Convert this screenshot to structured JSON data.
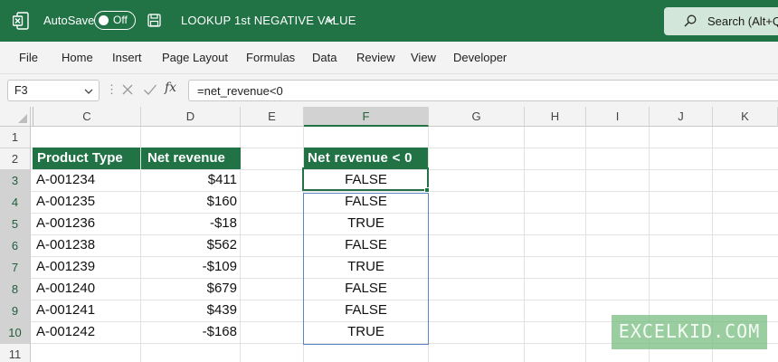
{
  "title_bar": {
    "autosave_label": "AutoSave",
    "autosave_state": "Off",
    "document_title": "LOOKUP 1st NEGATIVE VALUE",
    "search_placeholder": "Search (Alt+Q)",
    "accent_color": "#217346"
  },
  "ribbon": {
    "tabs": [
      "File",
      "Home",
      "Insert",
      "Page Layout",
      "Formulas",
      "Data",
      "Review",
      "View",
      "Developer"
    ]
  },
  "formula_bar": {
    "name_box": "F3",
    "formula": "=net_revenue<0",
    "fx_label": "fx"
  },
  "grid": {
    "columns": [
      "C",
      "D",
      "E",
      "F",
      "G",
      "H",
      "I",
      "J",
      "K"
    ],
    "rows": [
      "1",
      "2",
      "3",
      "4",
      "5",
      "6",
      "7",
      "8",
      "9",
      "10",
      "11"
    ],
    "selected_column": "F",
    "active_cell": "F3",
    "table": {
      "headers": {
        "product_type": "Product Type",
        "net_revenue": "Net revenue",
        "net_revenue_lt0": "Net revenue < 0"
      },
      "rows": [
        {
          "product": "A-001234",
          "revenue": "$411",
          "negative": "FALSE"
        },
        {
          "product": "A-001235",
          "revenue": "$160",
          "negative": "FALSE"
        },
        {
          "product": "A-001236",
          "revenue": "-$18",
          "negative": "TRUE"
        },
        {
          "product": "A-001238",
          "revenue": "$562",
          "negative": "FALSE"
        },
        {
          "product": "A-001239",
          "revenue": "-$109",
          "negative": "TRUE"
        },
        {
          "product": "A-001240",
          "revenue": "$679",
          "negative": "FALSE"
        },
        {
          "product": "A-001241",
          "revenue": "$439",
          "negative": "FALSE"
        },
        {
          "product": "A-001242",
          "revenue": "-$168",
          "negative": "TRUE"
        }
      ]
    }
  },
  "watermark": "EXCELKID.COM"
}
